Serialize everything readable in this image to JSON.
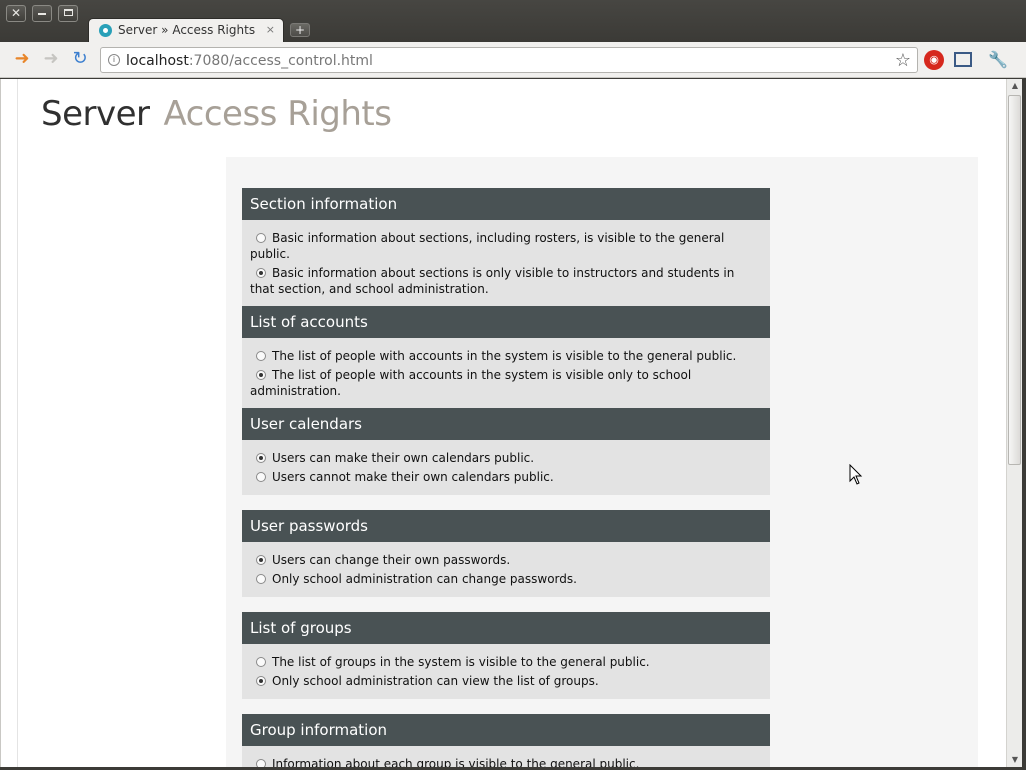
{
  "browser": {
    "tab_title": "Server » Access Rights",
    "tab_close": "×",
    "new_tab": "+",
    "url_host": "localhost",
    "url_rest": ":7080/access_control.html",
    "icons": {
      "back": "arrow-left-icon",
      "forward": "arrow-right-icon",
      "reload": "reload-icon",
      "bookmark": "star-icon",
      "adblock": "adblock-icon",
      "fullscreen": "fullscreen-icon",
      "menu": "wrench-icon"
    }
  },
  "page": {
    "title_main": "Server",
    "title_sub": "Access Rights"
  },
  "sections": [
    {
      "title": "Section information",
      "options": [
        {
          "label": "Basic information about sections, including rosters, is visible to the general public.",
          "checked": false
        },
        {
          "label": "Basic information about sections is only visible to instructors and students in that section, and school administration.",
          "checked": true
        }
      ]
    },
    {
      "title": "List of accounts",
      "options": [
        {
          "label": "The list of people with accounts in the system is visible to the general public.",
          "checked": false
        },
        {
          "label": "The list of people with accounts in the system is visible only to school administration.",
          "checked": true
        }
      ]
    },
    {
      "title": "User calendars",
      "options": [
        {
          "label": "Users can make their own calendars public.",
          "checked": true
        },
        {
          "label": "Users cannot make their own calendars public.",
          "checked": false
        }
      ]
    },
    {
      "title": "User passwords",
      "options": [
        {
          "label": "Users can change their own passwords.",
          "checked": true
        },
        {
          "label": "Only school administration can change passwords.",
          "checked": false
        }
      ]
    },
    {
      "title": "List of groups",
      "options": [
        {
          "label": "The list of groups in the system is visible to the general public.",
          "checked": false
        },
        {
          "label": "Only school administration can view the list of groups.",
          "checked": true
        }
      ]
    },
    {
      "title": "Group information",
      "options": [
        {
          "label": "Information about each group is visible to the general public.",
          "checked": false
        }
      ]
    }
  ]
}
